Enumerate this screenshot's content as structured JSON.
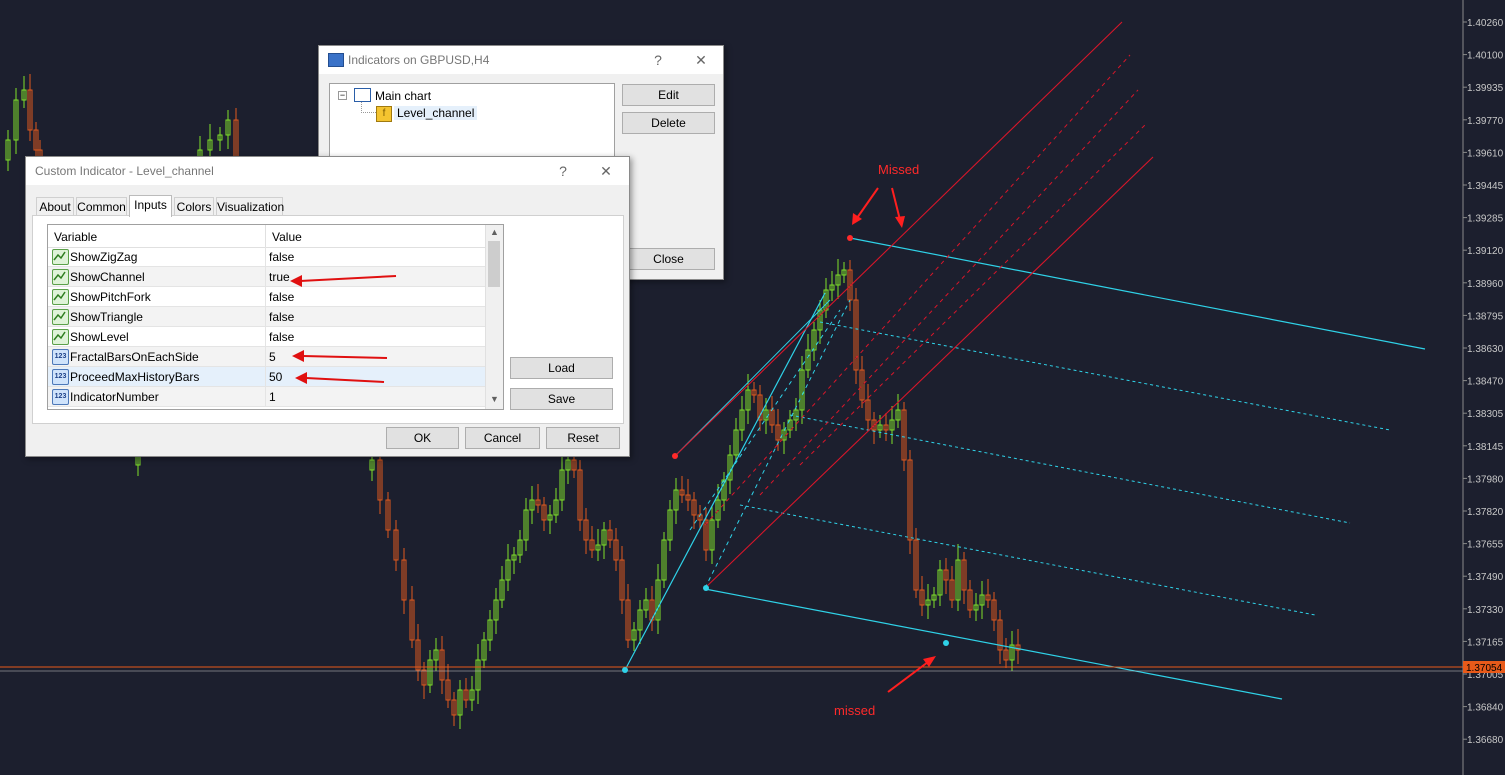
{
  "chart": {
    "symbol_timeframe": "GBPUSD,H4",
    "price_levels": [
      "1.40260",
      "1.40100",
      "1.39935",
      "1.39770",
      "1.39610",
      "1.39445",
      "1.39285",
      "1.39120",
      "1.38960",
      "1.38795",
      "1.38630",
      "1.38470",
      "1.38305",
      "1.38145",
      "1.37980",
      "1.37820",
      "1.37655",
      "1.37490",
      "1.37330",
      "1.37165",
      "1.37005",
      "1.36840",
      "1.36680"
    ],
    "current_price": "1.37054",
    "annotations": {
      "top": "Missed",
      "bottom": "missed"
    },
    "colors": {
      "background": "#1c1f2e",
      "bull": "#7fe02a",
      "bear": "#e05a1e",
      "cyan": "#2fd2e8",
      "red": "#d8162a",
      "price_line": "#e85a1a"
    }
  },
  "indicators_window": {
    "title": "Indicators on GBPUSD,H4",
    "help": "?",
    "close_glyph": "✕",
    "tree": {
      "root": "Main chart",
      "child": "Level_channel"
    },
    "buttons": {
      "edit": "Edit",
      "delete": "Delete",
      "close": "Close"
    }
  },
  "custom_indicator_window": {
    "title": "Custom Indicator - Level_channel",
    "help": "?",
    "close_glyph": "✕",
    "tabs": [
      "About",
      "Common",
      "Inputs",
      "Colors",
      "Visualization"
    ],
    "active_tab": "Inputs",
    "grid_headers": {
      "variable": "Variable",
      "value": "Value"
    },
    "rows": [
      {
        "name": "ShowZigZag",
        "value": "false",
        "type": "bool"
      },
      {
        "name": "ShowChannel",
        "value": "true",
        "type": "bool"
      },
      {
        "name": "ShowPitchFork",
        "value": "false",
        "type": "bool"
      },
      {
        "name": "ShowTriangle",
        "value": "false",
        "type": "bool"
      },
      {
        "name": "ShowLevel",
        "value": "false",
        "type": "bool"
      },
      {
        "name": "FractalBarsOnEachSide",
        "value": "5",
        "type": "int"
      },
      {
        "name": "ProceedMaxHistoryBars",
        "value": "50",
        "type": "int"
      },
      {
        "name": "IndicatorNumber",
        "value": "1",
        "type": "int"
      }
    ],
    "int_icon_text": "123",
    "buttons": {
      "load": "Load",
      "save": "Save",
      "ok": "OK",
      "cancel": "Cancel",
      "reset": "Reset"
    }
  }
}
